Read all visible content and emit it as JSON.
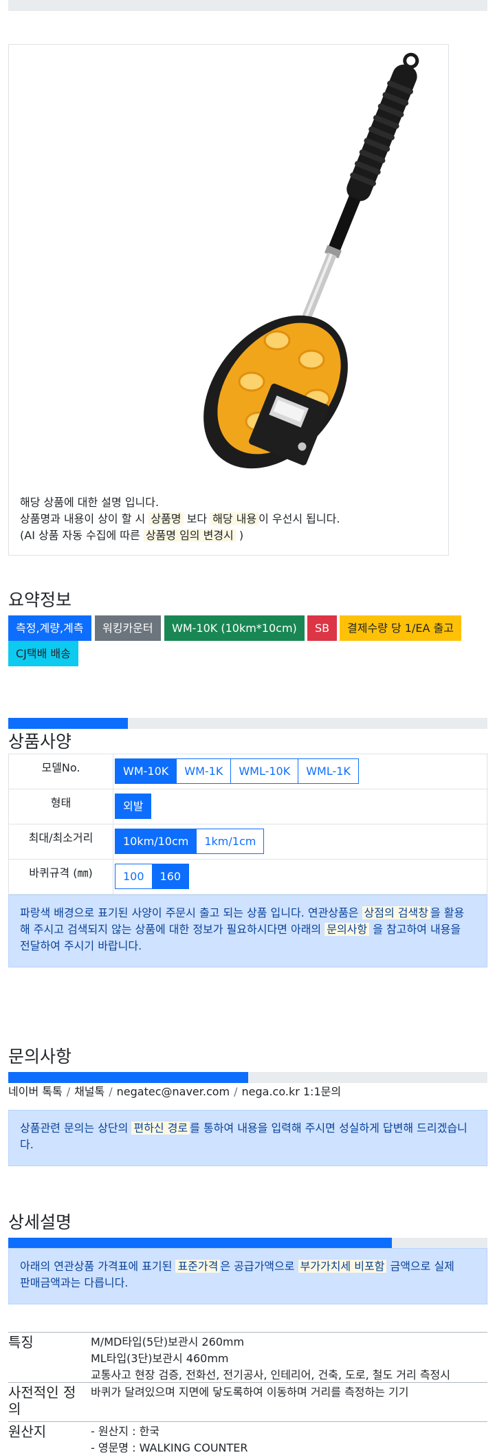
{
  "card": {
    "line1": "해당 상품에 대한 설명 입니다.",
    "line2_a": "상품명과 내용이 상이 할 시 ",
    "line2_mark1": "상품명",
    "line2_b": " 보다 ",
    "line2_mark2": "해당 내용",
    "line2_c": "이 우선시 됩니다.",
    "line3_a": "(AI 상품 자동 수집에 따른 ",
    "line3_mark": "상품명 임의 변경시",
    "line3_b": " )"
  },
  "summary": {
    "title": "요약정보",
    "badges": [
      {
        "label": "측정,계량,계측",
        "color": "#0d6efd"
      },
      {
        "label": "워킹카운터",
        "color": "#6c757d"
      },
      {
        "label": "WM-10K (10km*10cm)",
        "color": "#198754"
      },
      {
        "label": "SB",
        "color": "#dc3545"
      },
      {
        "label": "결제수량 당 1/EA 출고",
        "color": "#ffc107"
      },
      {
        "label": "CJ택배 배송",
        "color": "#0dcaf0"
      }
    ]
  },
  "spec": {
    "title": "상품사양",
    "progress": 0.25,
    "rows": [
      {
        "label": "모델No.",
        "options": [
          "WM-10K",
          "WM-1K",
          "WML-10K",
          "WML-1K"
        ],
        "active": 0
      },
      {
        "label": "형태",
        "options": [
          "외발"
        ],
        "active": 0
      },
      {
        "label": "최대/최소거리",
        "options": [
          "10km/10cm",
          "1km/1cm"
        ],
        "active": 0
      },
      {
        "label": "바퀴규격 (㎜)",
        "options": [
          "100",
          "160"
        ],
        "active": 1
      }
    ],
    "alert_a": "파랑색 배경으로 표기된 사양이 주문시 출고 되는 상품 입니다. 연관상품은 ",
    "alert_mark1": "상점의 검색창",
    "alert_b": "을 활용",
    "alert_c": "해 주시고 검색되지 않는 상품에 대한 정보가 필요하시다면 아래의 ",
    "alert_mark2": "문의사항",
    "alert_d": " 을 참고하여 내용을",
    "alert_e": "전달하여 주시기 바랍니다."
  },
  "inquiry": {
    "title": "문의사항",
    "progress": 0.5,
    "contacts": [
      "네이버 톡톡",
      "채널톡",
      "negatec@naver.com",
      "nega.co.kr 1:1문의"
    ],
    "alert_a": "상품관련 문의는 상단의 ",
    "alert_mark": "편하신 경로",
    "alert_b": "를 통하여 내용을 입력해 주시면 성실하게 답변해 드리겠습니",
    "alert_c": "다."
  },
  "detail": {
    "title": "상세설명",
    "progress": 0.8,
    "alert_a": "아래의 연관상품 가격표에 표기된 ",
    "alert_mark1": "표준가격",
    "alert_b": "은 공급가액으로 ",
    "alert_mark2": "부가가치세 비포함",
    "alert_c": " 금액으로 실제",
    "alert_d": "판매금액과는 다릅니다.",
    "rows": [
      {
        "key": "특징",
        "values": [
          "M/MD타입(5단)보관시 260mm",
          "ML타입(3단)보관시 460mm",
          "교통사고 현장 검증, 전화선, 전기공사, 인테리어, 건축, 도로, 철도 거리 측정시"
        ]
      },
      {
        "key": "사전적인 정의",
        "values": [
          "바퀴가 달려있으며 지면에 닿도록하여 이동하며 거리를 측정하는 기기"
        ]
      },
      {
        "key": "원산지",
        "values": [
          "- 원산지 : 한국",
          "- 영문명 : WALKING COUNTER"
        ]
      }
    ]
  }
}
